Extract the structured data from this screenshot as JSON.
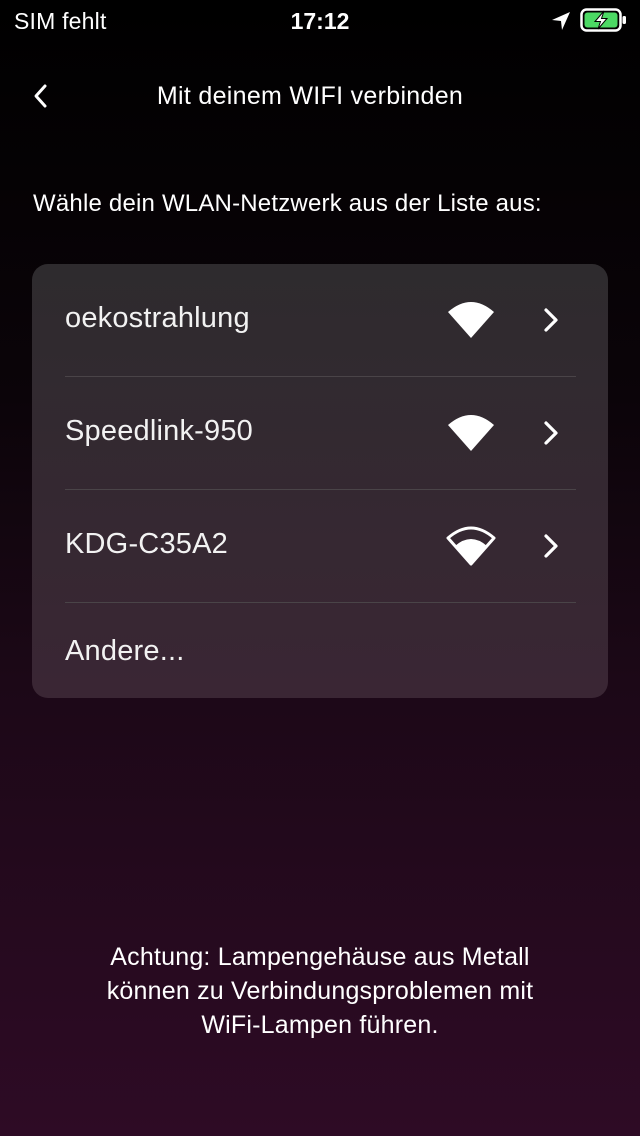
{
  "status_bar": {
    "carrier": "SIM fehlt",
    "time": "17:12",
    "battery_color": "#4cd964"
  },
  "nav": {
    "title": "Mit deinem WIFI verbinden"
  },
  "instruction": "Wähle dein WLAN-Netzwerk aus der Liste aus:",
  "networks": [
    {
      "name": "oekostrahlung",
      "signal": "full",
      "icon": "wifi-full-icon"
    },
    {
      "name": "Speedlink-950",
      "signal": "full",
      "icon": "wifi-full-icon"
    },
    {
      "name": "KDG-C35A2",
      "signal": "medium",
      "icon": "wifi-medium-icon"
    }
  ],
  "other_label": "Andere...",
  "warning": {
    "line1": "Achtung: Lampengehäuse aus Metall",
    "line2": "können zu Verbindungsproblemen mit",
    "line3": "WiFi-Lampen führen."
  }
}
